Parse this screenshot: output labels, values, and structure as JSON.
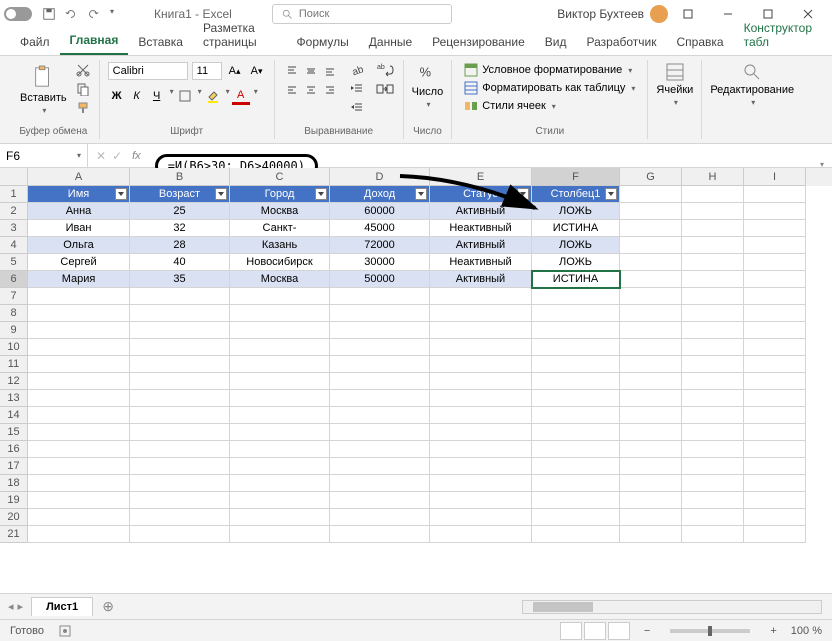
{
  "titlebar": {
    "autosave_label": "",
    "doc_title": "Книга1 - Excel",
    "search_placeholder": "Поиск",
    "user_name": "Виктор Бухтеев"
  },
  "tabs": {
    "file": "Файл",
    "home": "Главная",
    "insert": "Вставка",
    "layout": "Разметка страницы",
    "formulas": "Формулы",
    "data": "Данные",
    "review": "Рецензирование",
    "view": "Вид",
    "developer": "Разработчик",
    "help": "Справка",
    "table_design": "Конструктор табл"
  },
  "ribbon": {
    "clipboard": {
      "paste": "Вставить",
      "label": "Буфер обмена"
    },
    "font": {
      "name": "Calibri",
      "size": "11",
      "label": "Шрифт"
    },
    "alignment": {
      "label": "Выравнивание"
    },
    "number": {
      "btn": "Число",
      "label": "Число"
    },
    "styles": {
      "cond_fmt": "Условное форматирование",
      "fmt_table": "Форматировать как таблицу",
      "cell_styles": "Стили ячеек",
      "label": "Стили"
    },
    "cells": {
      "btn": "Ячейки"
    },
    "editing": {
      "btn": "Редактирование"
    }
  },
  "namebox": "F6",
  "formula": "=И(B6>30; D6>40000)",
  "col_letters": [
    "A",
    "B",
    "C",
    "D",
    "E",
    "F",
    "G",
    "H",
    "I"
  ],
  "table": {
    "headers": [
      "Имя",
      "Возраст",
      "Город",
      "Доход",
      "Статус",
      "Столбец1"
    ],
    "rows": [
      [
        "Анна",
        "25",
        "Москва",
        "60000",
        "Активный",
        "ЛОЖЬ"
      ],
      [
        "Иван",
        "32",
        "Санкт-",
        "45000",
        "Неактивный",
        "ИСТИНА"
      ],
      [
        "Ольга",
        "28",
        "Казань",
        "72000",
        "Активный",
        "ЛОЖЬ"
      ],
      [
        "Сергей",
        "40",
        "Новосибирск",
        "30000",
        "Неактивный",
        "ЛОЖЬ"
      ],
      [
        "Мария",
        "35",
        "Москва",
        "50000",
        "Активный",
        "ИСТИНА"
      ]
    ]
  },
  "sheet_tab": "Лист1",
  "status": {
    "ready": "Готово",
    "zoom": "100 %"
  }
}
